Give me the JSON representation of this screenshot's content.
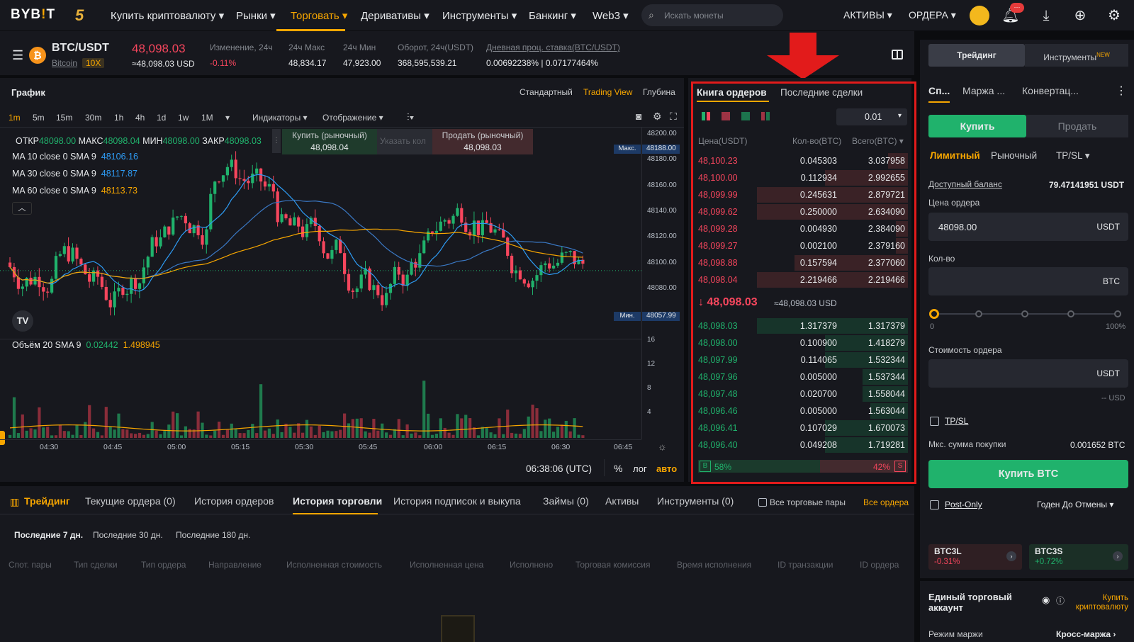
{
  "topbar": {
    "logo_a": "BYB",
    "logo_b": "!",
    "logo_c": "T",
    "nav5": "5",
    "nav": [
      "Купить криптовалюту ▾",
      "Рынки ▾",
      "Торговать ▾",
      "Деривативы ▾",
      "Инструменты ▾",
      "Банкинг ▾",
      "Web3 ▾"
    ],
    "search_placeholder": "Искать монеты",
    "assets": "АКТИВЫ ▾",
    "orders": "ОРДЕРА ▾",
    "notif_badge": "···"
  },
  "ticker": {
    "pair": "BTC/USDT",
    "coin": "Bitcoin",
    "leverage": "10X",
    "price": "48,098.03",
    "price_usd": "≈48,098.03 USD",
    "change_label": "Изменение, 24ч",
    "change": "-0.11%",
    "high_label": "24ч Макс",
    "high": "48,834.17",
    "low_label": "24ч Мин",
    "low": "47,923.00",
    "turnover_label": "Оборот, 24ч(USDT)",
    "turnover": "368,595,539.21",
    "rate_label": "Дневная проц. ставка(BTC/USDT)",
    "rate": "0.00692238% | 0.07177464%"
  },
  "chart": {
    "title": "График",
    "views": [
      "Стандартный",
      "Trading View",
      "Глубина"
    ],
    "intervals": [
      "1m",
      "5m",
      "15m",
      "30m",
      "1h",
      "4h",
      "1d",
      "1w",
      "1M"
    ],
    "indicators": "Индикаторы ▾",
    "display": "Отображение ▾",
    "ohlc": {
      "o_l": "ОТКР",
      "o": "48098.00",
      "h_l": "МАКС",
      "h": "48098.04",
      "l_l": "МИН",
      "l": "48098.00",
      "c_l": "ЗАКР",
      "c": "48098.03"
    },
    "ma": [
      {
        "label": "MA 10 close 0 SMA 9",
        "value": "48106.16",
        "color": "#2e9cf5"
      },
      {
        "label": "MA 30 close 0 SMA 9",
        "value": "48117.87",
        "color": "#2e9cf5"
      },
      {
        "label": "MA 60 close 0 SMA 9",
        "value": "48113.73",
        "color": "#f7a600"
      }
    ],
    "buy_market": "Купить (рыночный)",
    "buy_price": "48,098.04",
    "qty_placeholder": "Указать кол",
    "sell_market": "Продать (рыночный)",
    "sell_price": "48,098.03",
    "yaxis": [
      "48200.00",
      "48180.00",
      "48160.00",
      "48140.00",
      "48120.00",
      "48100.00",
      "48080.00"
    ],
    "max_label": "Макс.",
    "max_val": "48188.00",
    "min_label": "Мин.",
    "min_val": "48057.99",
    "vol_label": "Объём 20 SMA 9",
    "vol_a": "0.02442",
    "vol_b": "1.498945",
    "vol_axis": [
      "16",
      "12",
      "8",
      "4"
    ],
    "xaxis": [
      "04:30",
      "04:45",
      "05:00",
      "05:15",
      "05:30",
      "05:45",
      "06:00",
      "06:15",
      "06:30",
      "06:45"
    ],
    "time": "06:38:06 (UTC)",
    "pct": "%",
    "log": "лог",
    "auto": "авто"
  },
  "chart_data": {
    "type": "candlestick",
    "series": [
      {
        "name": "MA 10",
        "value": 48106.16
      },
      {
        "name": "MA 30",
        "value": 48117.87
      },
      {
        "name": "MA 60",
        "value": 48113.73
      }
    ],
    "ylim": [
      48057.99,
      48200
    ],
    "max": 48188.0,
    "min": 48057.99
  },
  "orderbook": {
    "tab1": "Книга ордеров",
    "tab2": "Последние сделки",
    "step": "0.01",
    "h_price": "Цена(USDT)",
    "h_qty": "Кол-во(BTC)",
    "h_total": "Всего(BTC) ▾",
    "asks": [
      [
        "48,100.23",
        "0.045303",
        "3.037958",
        0.13
      ],
      [
        "48,100.00",
        "0.112934",
        "2.992655",
        0.55
      ],
      [
        "48,099.99",
        "0.245631",
        "2.879721",
        1.0
      ],
      [
        "48,099.62",
        "0.250000",
        "2.634090",
        1.0
      ],
      [
        "48,099.28",
        "0.004930",
        "2.384090",
        0.08
      ],
      [
        "48,099.27",
        "0.002100",
        "2.379160",
        0.08
      ],
      [
        "48,098.88",
        "0.157594",
        "2.377060",
        0.75
      ],
      [
        "48,098.04",
        "2.219466",
        "2.219466",
        1.0
      ]
    ],
    "mid": "↓ 48,098.03",
    "mid_usd": "≈48,098.03 USD",
    "bids": [
      [
        "48,098.03",
        "1.317379",
        "1.317379",
        1.0
      ],
      [
        "48,098.00",
        "0.100900",
        "1.418279",
        0.55
      ],
      [
        "48,097.99",
        "0.114065",
        "1.532344",
        0.55
      ],
      [
        "48,097.96",
        "0.005000",
        "1.537344",
        0.3
      ],
      [
        "48,097.48",
        "0.020700",
        "1.558044",
        0.3
      ],
      [
        "48,096.46",
        "0.005000",
        "1.563044",
        0.25
      ],
      [
        "48,096.41",
        "0.107029",
        "1.670073",
        0.55
      ],
      [
        "48,096.40",
        "0.049208",
        "1.719281",
        0.55
      ]
    ],
    "b": "B",
    "b_pct": "58%",
    "s_pct": "42%",
    "s": "S"
  },
  "trade": {
    "tab1": "Трейдинг",
    "tab2": "Инструменты",
    "new": "NEW",
    "types": [
      "Сп...",
      "Маржа ...",
      "Конвертац..."
    ],
    "buy": "Купить",
    "sell": "Продать",
    "order_types": [
      "Лимитный",
      "Рыночный",
      "TP/SL ▾"
    ],
    "bal_label": "Доступный баланс",
    "bal": "79.47141951 USDT",
    "price_label": "Цена ордера",
    "price": "48098.00",
    "unit_usdt": "USDT",
    "qty_label": "Кол-во",
    "unit_btc": "BTC",
    "slider_min": "0",
    "slider_max": "100%",
    "cost_label": "Стоимость ордера",
    "cost_usd": "-- USD",
    "tpsl": "TP/SL",
    "max_buy_label": "Мкс. сумма покупки",
    "max_buy": "0.001652 BTC",
    "buy_btc": "Купить BTC",
    "postonly": "Post-Only",
    "gtc": "Годен До Отмены ▾",
    "lev1": "BTC3L",
    "lev1_chg": "-0.31%",
    "lev2": "BTC3S",
    "lev2_chg": "+0.72%",
    "uta": "Единый торговый аккаунт",
    "buy_crypto": "Купить криптовалюту",
    "margin_mode_label": "Режим маржи",
    "margin_mode": "Кросс-маржа"
  },
  "bottom": {
    "tabs": [
      "Трейдинг",
      "Текущие ордера (0)",
      "История ордеров",
      "История торговли",
      "История подписок и выкупа",
      "Займы (0)",
      "Активы",
      "Инструменты (0)"
    ],
    "all_pairs": "Все торговые пары",
    "all_orders": "Все ордера",
    "periods": [
      "Последние 7 дн.",
      "Последние 30 дн.",
      "Последние 180 дн."
    ],
    "headers": [
      "Спот. пары",
      "Тип сделки",
      "Тип ордера",
      "Направление",
      "Исполненная стоимость",
      "Исполненная цена",
      "Исполнено",
      "Торговая комиссия",
      "Время исполнения",
      "ID транзакции",
      "ID ордера"
    ]
  }
}
